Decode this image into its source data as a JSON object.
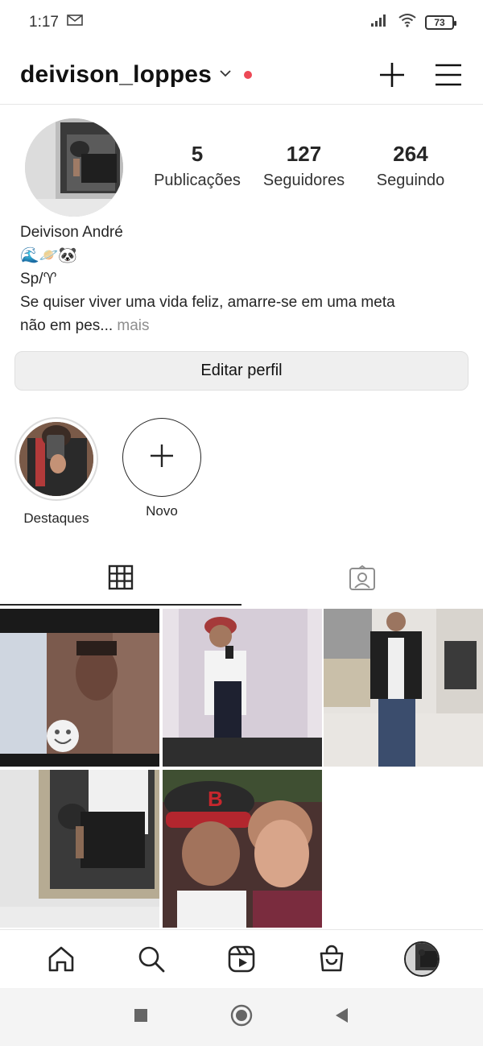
{
  "status_bar": {
    "time": "1:17",
    "battery": "73"
  },
  "header": {
    "username": "deivison_loppes"
  },
  "profile": {
    "stats": [
      {
        "value": "5",
        "label": "Publicações"
      },
      {
        "value": "127",
        "label": "Seguidores"
      },
      {
        "value": "264",
        "label": "Seguindo"
      }
    ],
    "name": "Deivison André",
    "emoji_line": "🌊🪐🐼",
    "location_line": "Sp/♈",
    "bio_line1": "Se quiser viver uma vida feliz, amarre-se em uma meta",
    "bio_line2": "não em pes...",
    "more": " mais",
    "edit_button": "Editar perfil"
  },
  "highlights": [
    {
      "label": "Destaques"
    },
    {
      "label": "Novo"
    }
  ],
  "colors": {
    "accent_dot": "#ed4956",
    "text": "#262626",
    "muted": "#8e8e8e"
  },
  "icons": {
    "header": [
      "chevron-down-icon",
      "new-post-plus-icon",
      "menu-icon"
    ],
    "tabs": [
      "grid-icon",
      "tagged-icon"
    ],
    "bottom_nav": [
      "home-icon",
      "search-icon",
      "reels-icon",
      "shop-icon",
      "profile-avatar"
    ],
    "android": [
      "recents-square-icon",
      "home-circle-icon",
      "back-triangle-icon"
    ]
  }
}
